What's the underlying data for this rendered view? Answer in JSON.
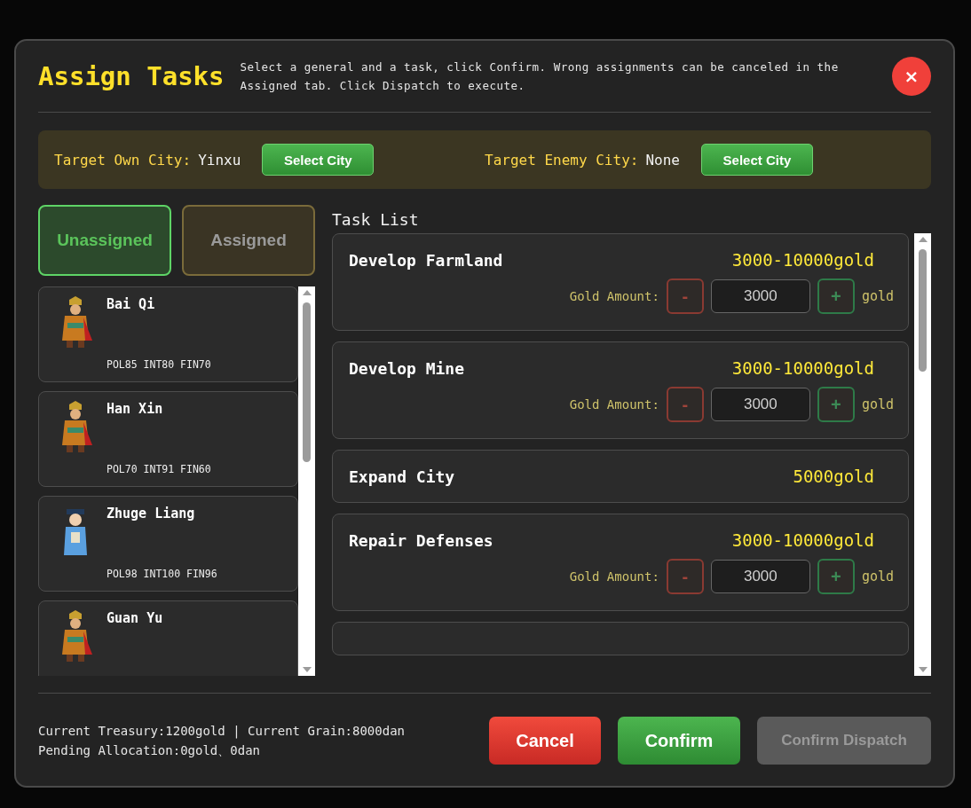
{
  "dialog": {
    "title": "Assign Tasks",
    "description": "Select a general and a task, click Confirm. Wrong assignments can be canceled in the Assigned tab. Click Dispatch to execute.",
    "close_label": "×"
  },
  "targets": [
    {
      "label": "Target Own City:",
      "value": "Yinxu",
      "button": "Select City"
    },
    {
      "label": "Target Enemy City:",
      "value": "None",
      "button": "Select City"
    }
  ],
  "tabs": [
    {
      "label": "Unassigned",
      "selected": true
    },
    {
      "label": "Assigned",
      "selected": false
    }
  ],
  "generals": [
    {
      "name": "Bai Qi",
      "kind": "warrior",
      "stats": "POL85 INT80 FIN70"
    },
    {
      "name": "Han Xin",
      "kind": "warrior",
      "stats": "POL70 INT91 FIN60"
    },
    {
      "name": "Zhuge Liang",
      "kind": "scholar",
      "stats": "POL98 INT100 FIN96"
    },
    {
      "name": "Guan Yu",
      "kind": "warrior"
    }
  ],
  "task_list": {
    "title": "Task List",
    "tasks": [
      {
        "name": "Develop Farmland",
        "cost": "3000-10000gold",
        "kind": "adjustable",
        "amount_label": "Gold Amount:",
        "minus": "-",
        "value": "3000",
        "plus": "+",
        "unit": "gold"
      },
      {
        "name": "Develop Mine",
        "cost": "3000-10000gold",
        "kind": "adjustable",
        "amount_label": "Gold Amount:",
        "minus": "-",
        "value": "3000",
        "plus": "+",
        "unit": "gold"
      },
      {
        "name": "Expand City",
        "cost": "5000gold",
        "kind": "fixed"
      },
      {
        "name": "Repair Defenses",
        "cost": "3000-10000gold",
        "kind": "adjustable",
        "amount_label": "Gold Amount:",
        "minus": "-",
        "value": "3000",
        "plus": "+",
        "unit": "gold"
      },
      {
        "kind": "partial"
      }
    ]
  },
  "footer": {
    "summary": "Current Treasury:1200gold | Current Grain:8000dan",
    "pending": "Pending Allocation:0gold、0dan",
    "buttons": [
      {
        "label": "Cancel",
        "kind": "cancel",
        "disabled": false
      },
      {
        "label": "Confirm",
        "kind": "confirm",
        "disabled": false
      },
      {
        "label": "Confirm Dispatch",
        "kind": "dispatch",
        "disabled": true
      }
    ]
  }
}
